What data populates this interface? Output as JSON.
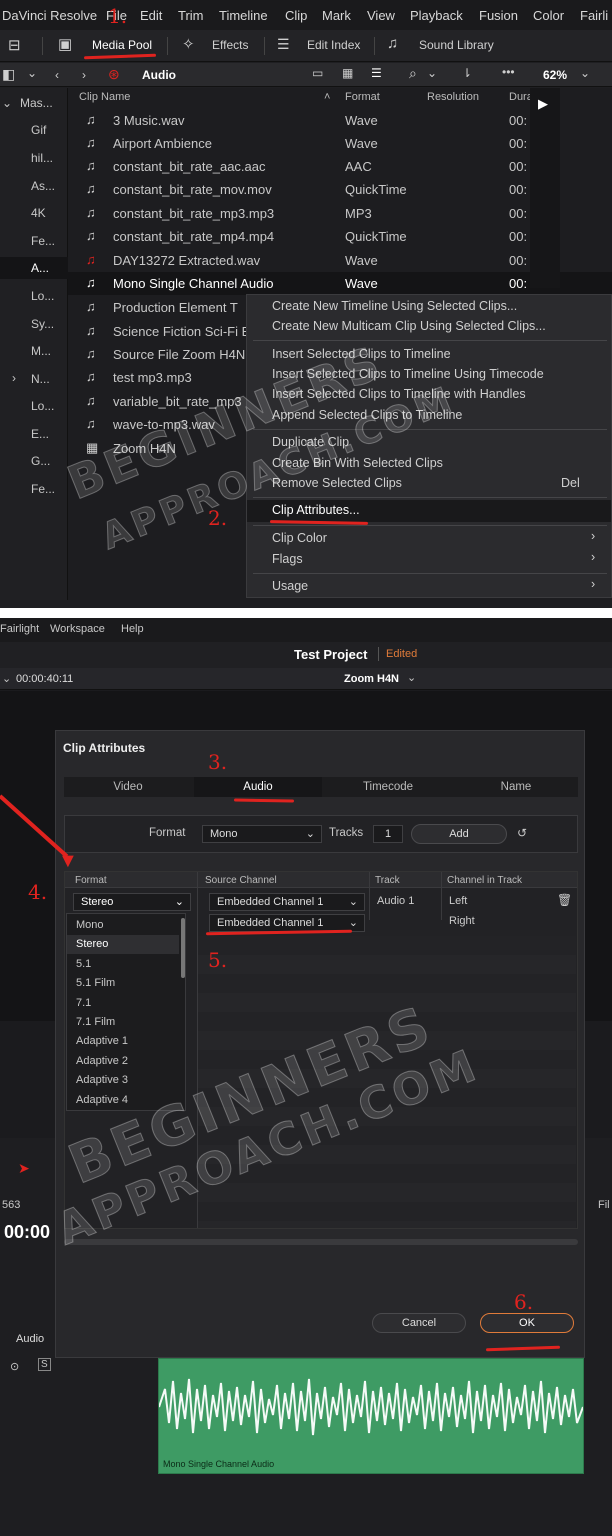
{
  "menubar": {
    "items": [
      "DaVinci Resolve",
      "File",
      "Edit",
      "Trim",
      "Timeline",
      "Clip",
      "Mark",
      "View",
      "Playback",
      "Fusion",
      "Color",
      "Fairli"
    ]
  },
  "toolbar": {
    "media_pool": "Media Pool",
    "effects": "Effects",
    "edit_index": "Edit Index",
    "sound_library": "Sound Library"
  },
  "subbar": {
    "bin_name": "Audio",
    "zoom": "62%"
  },
  "bins": [
    "Mas...",
    "Gif",
    "hil...",
    "As...",
    "4K",
    "Fe...",
    "A...",
    "Lo...",
    "Sy...",
    "M...",
    "N...",
    "Lo...",
    "E...",
    "G...",
    "Fe..."
  ],
  "columns": {
    "clip_name": "Clip Name",
    "format": "Format",
    "resolution": "Resolution",
    "duration": "Dura"
  },
  "clips": [
    {
      "name": "3 Music.wav",
      "format": "Wave",
      "dur": "00:"
    },
    {
      "name": "Airport Ambience",
      "format": "Wave",
      "dur": "00:"
    },
    {
      "name": "constant_bit_rate_aac.aac",
      "format": "AAC",
      "dur": "00:"
    },
    {
      "name": "constant_bit_rate_mov.mov",
      "format": "QuickTime",
      "dur": "00:"
    },
    {
      "name": "constant_bit_rate_mp3.mp3",
      "format": "MP3",
      "dur": "00:"
    },
    {
      "name": "constant_bit_rate_mp4.mp4",
      "format": "QuickTime",
      "dur": "00:"
    },
    {
      "name": "DAY13272 Extracted.wav",
      "format": "Wave",
      "dur": "00:"
    },
    {
      "name": "Mono Single Channel Audio",
      "format": "Wave",
      "dur": "00:"
    },
    {
      "name": "Production Element T",
      "format": "",
      "dur": ""
    },
    {
      "name": "Science Fiction Sci-Fi E",
      "format": "",
      "dur": ""
    },
    {
      "name": "Source File Zoom H4N",
      "format": "",
      "dur": ""
    },
    {
      "name": "test mp3.mp3",
      "format": "",
      "dur": ""
    },
    {
      "name": "variable_bit_rate_mp3",
      "format": "",
      "dur": ""
    },
    {
      "name": "wave-to-mp3.wav",
      "format": "",
      "dur": ""
    },
    {
      "name": "Zoom H4N",
      "format": "",
      "dur": ""
    }
  ],
  "context_menu": {
    "create_timeline": "Create New Timeline Using Selected Clips...",
    "create_multicam": "Create New Multicam Clip Using Selected Clips...",
    "insert": "Insert Selected Clips to Timeline",
    "insert_timecode": "Insert Selected Clips to Timeline Using Timecode",
    "insert_handles": "Insert Selected Clips to Timeline with Handles",
    "append": "Append Selected Clips to Timeline",
    "duplicate": "Duplicate Clip",
    "create_bin": "Create Bin With Selected Clips",
    "remove": "Remove Selected Clips",
    "remove_shortcut": "Del",
    "clip_attributes": "Clip Attributes...",
    "clip_color": "Clip Color",
    "flags": "Flags",
    "usage": "Usage"
  },
  "annotations": {
    "a1": "1.",
    "a2": "2.",
    "a3": "3.",
    "a4": "4.",
    "a5": "5.",
    "a6": "6."
  },
  "bottom": {
    "menu_fairlight": "Fairlight",
    "menu_workspace": "Workspace",
    "menu_help": "Help",
    "project_title": "Test Project",
    "project_status": "Edited",
    "timecode": "00:00:40:11",
    "viewer_clip": "Zoom H4N",
    "left_tc_big": "00:00",
    "left_fps": "563",
    "audio_track": "Audio",
    "right_cut": "Fil",
    "track_clip_name": "Mono Single Channel Audio"
  },
  "dialog": {
    "title": "Clip Attributes",
    "tabs": [
      "Video",
      "Audio",
      "Timecode",
      "Name"
    ],
    "active_tab": "Audio",
    "format_label": "Format",
    "format_value": "Mono",
    "tracks_label": "Tracks",
    "tracks_value": "1",
    "add_button": "Add",
    "table_headers": {
      "format": "Format",
      "source_channel": "Source Channel",
      "track": "Track",
      "channel_in_track": "Channel in Track"
    },
    "row": {
      "format": "Stereo",
      "source1": "Embedded Channel 1",
      "source2": "Embedded Channel 1",
      "track": "Audio 1",
      "ch1": "Left",
      "ch2": "Right"
    },
    "format_options": [
      "Mono",
      "Stereo",
      "5.1",
      "5.1 Film",
      "7.1",
      "7.1 Film",
      "Adaptive 1",
      "Adaptive 2",
      "Adaptive 3",
      "Adaptive 4"
    ],
    "selected_option": "Stereo",
    "cancel": "Cancel",
    "ok": "OK"
  },
  "watermark": {
    "line1": "BEGINNERS",
    "line2": "APPROACH.COM"
  },
  "colors": {
    "annotation_red": "#e0231f",
    "track_green": "#3e9b64",
    "panel_dark": "#1f1f22"
  }
}
